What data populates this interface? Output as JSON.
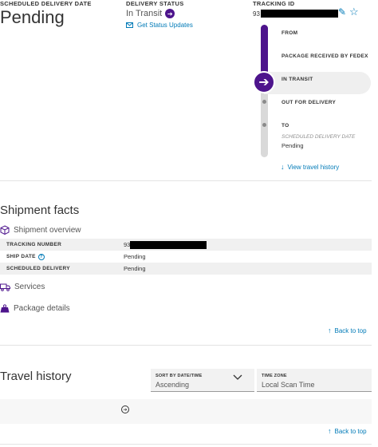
{
  "summary": {
    "scheduled_label": "SCHEDULED DELIVERY DATE",
    "scheduled_value": "Pending",
    "status_label": "DELIVERY STATUS",
    "status_value": "In Transit",
    "status_updates_link": "Get Status Updates",
    "tracking_label": "TRACKING ID",
    "tracking_prefix": "93"
  },
  "progress": {
    "from_label": "FROM",
    "received_label": "PACKAGE RECEIVED BY FEDEX",
    "transit_label": "IN TRANSIT",
    "out_label": "OUT FOR DELIVERY",
    "to_label": "TO",
    "sched_small": "SCHEDULED DELIVERY DATE",
    "sched_value": "Pending",
    "view_history": "View travel history"
  },
  "shipment_facts": {
    "title": "Shipment facts",
    "overview_title": "Shipment overview",
    "rows": [
      {
        "key": "TRACKING NUMBER",
        "value": "93"
      },
      {
        "key": "SHIP DATE",
        "value": "Pending"
      },
      {
        "key": "SCHEDULED DELIVERY",
        "value": "Pending"
      }
    ],
    "services_title": "Services",
    "package_title": "Package details",
    "back_to_top": "Back to top"
  },
  "travel_history": {
    "title": "Travel history",
    "sort_label": "SORT BY DATE/TIME",
    "sort_value": "Ascending",
    "tz_label": "TIME ZONE",
    "tz_value": "Local Scan Time",
    "back_to_top": "Back to top"
  },
  "colors": {
    "brand_purple": "#4d148c",
    "link_blue": "#007ab7"
  }
}
